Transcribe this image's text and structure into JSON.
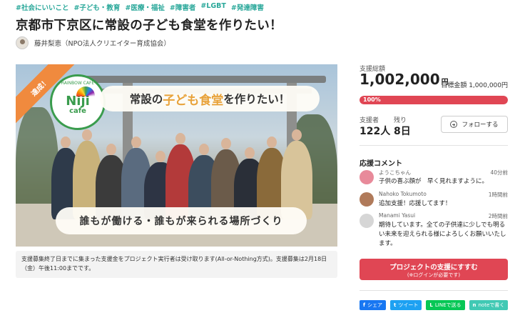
{
  "tags": [
    "#社会にいいこと",
    "#子ども・教育",
    "#医療・福祉",
    "#障害者",
    "#LGBT",
    "#発達障害"
  ],
  "title": "京都市下京区に常設の子ども食堂を作りたい！",
  "owner": {
    "name": "藤井梨恵（NPO法人クリエイター育成協会）"
  },
  "hero": {
    "ribbon": "達成！",
    "logo_arc": "RAINBOW CAFE",
    "logo_word": "Niji",
    "logo_sub": "cafe",
    "banner_top_pre": "常設の",
    "banner_top_hl": "子ども食堂",
    "banner_top_post": "を作りたい！",
    "banner_bottom": "誰もが働ける・誰もが来られる場所づくり"
  },
  "notice": "支援募集終了日までに集まった支援金をプロジェクト実行者は受け取ります(All-or-Nothing方式)。支援募集は2月18日（金）午後11:00までです。",
  "funding": {
    "total_label": "支援総額",
    "amount": "1,002,000",
    "currency": "円",
    "goal_text": "目標金額 1,000,000円",
    "progress_text": "100%",
    "progress_fraction": 1.0,
    "supporters_label": "支援者",
    "supporters_value": "122人",
    "remaining_label": "残り",
    "remaining_value": "8日",
    "follow_label": "フォローする"
  },
  "comments": {
    "heading": "応援コメント",
    "items": [
      {
        "name": "ようこちゃん",
        "time": "40分前",
        "text": "子供の喜ぶ顔が　早く見れますように。",
        "avatar_color": "#e88a9a"
      },
      {
        "name": "Nahoko Tokumoto",
        "time": "1時間前",
        "text": "追加支援！応援してます！",
        "avatar_color": "#b07a5a"
      },
      {
        "name": "Manami Yasui",
        "time": "2時間前",
        "text": "期待しています。全ての子供達に少しでも明るい未来を迎えられる様によろしくお願いいたします。",
        "avatar_color": "#d6d6d6"
      }
    ]
  },
  "cta": {
    "main": "プロジェクトの支援にすすむ",
    "sub": "(※ログインが必要です)"
  },
  "share": [
    {
      "icon": "f",
      "label": "シェア",
      "color": "#1877f2"
    },
    {
      "icon": "t",
      "label": "ツイート",
      "color": "#1da1f2"
    },
    {
      "icon": "L",
      "label": "LINEで送る",
      "color": "#06c755"
    },
    {
      "icon": "n",
      "label": "noteで書く",
      "color": "#41c9b4"
    }
  ],
  "colors": {
    "accent": "#e04654",
    "tag": "#2aa89a",
    "ribbon": "#f08a3e"
  }
}
